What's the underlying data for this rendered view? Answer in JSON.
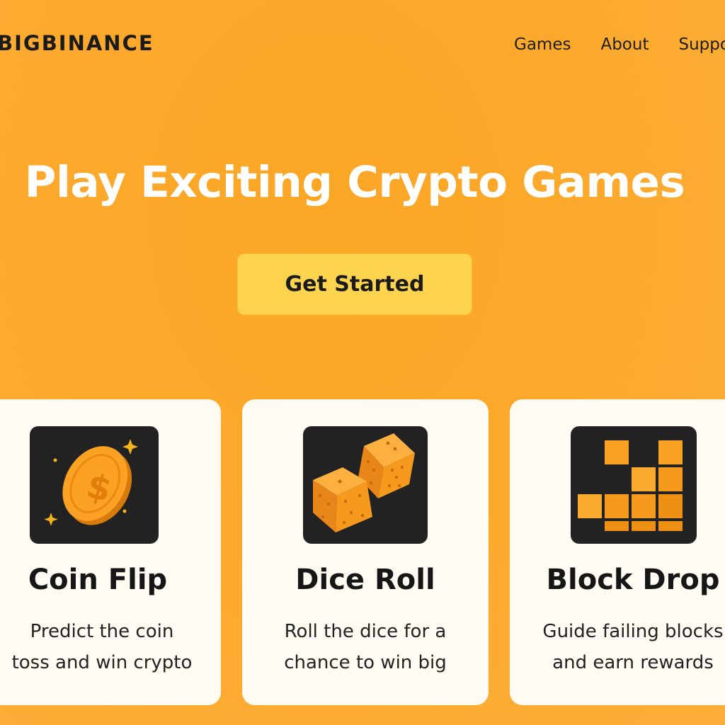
{
  "header": {
    "logo": "BIGBINANCE",
    "nav": [
      "Games",
      "About",
      "Suppo"
    ]
  },
  "hero": {
    "title": "Play Exciting Crypto Games",
    "cta_label": "Get Started"
  },
  "cards": [
    {
      "icon": "coin-icon",
      "title": "Coin Flip",
      "desc": [
        "Predict the coin",
        "toss and win crypto"
      ]
    },
    {
      "icon": "dice-icon",
      "title": "Dice Roll",
      "desc": [
        "Roll the dice for a",
        "chance to win big"
      ]
    },
    {
      "icon": "blocks-icon",
      "title": "Block Drop",
      "desc": [
        "Guide failing blocks",
        "and earn rewards"
      ]
    }
  ],
  "colors": {
    "background": "#fca82c",
    "cta": "#fed44f",
    "card": "#fffbf3",
    "icon_bg": "#222222",
    "accent": "#f59a1c"
  }
}
